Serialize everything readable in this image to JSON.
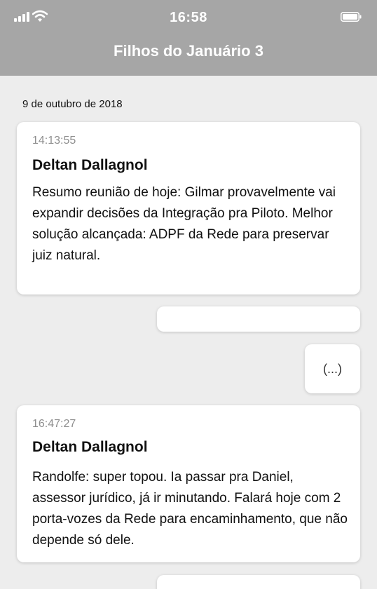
{
  "status_bar": {
    "time": "16:58",
    "icons": [
      "signal-icon",
      "wifi-icon",
      "battery-icon"
    ]
  },
  "header": {
    "title": "Filhos do Januário 3"
  },
  "chat": {
    "date": "9 de outubro de 2018",
    "messages": [
      {
        "timestamp": "14:13:55",
        "sender": "Deltan Dallagnol",
        "text": "Resumo reunião de hoje: Gilmar provavelmente vai expandir decisões da Integração pra Piloto. Melhor solução alcançada: ADPF da Rede para preservar juiz natural."
      },
      {
        "timestamp": "16:47:27",
        "sender": "Deltan Dallagnol",
        "text": "Randolfe: super topou. Ia passar pra Daniel, assessor jurídico, já ir minutando. Falará hoje com 2 porta-vozes da Rede para encaminhamento, que não depende só dele."
      }
    ],
    "redacted_reply": "(...)"
  },
  "colors": {
    "header_bg": "#a6a6a6",
    "chat_bg": "#ededed",
    "card_bg": "#ffffff",
    "timestamp": "#8e8e8e"
  }
}
